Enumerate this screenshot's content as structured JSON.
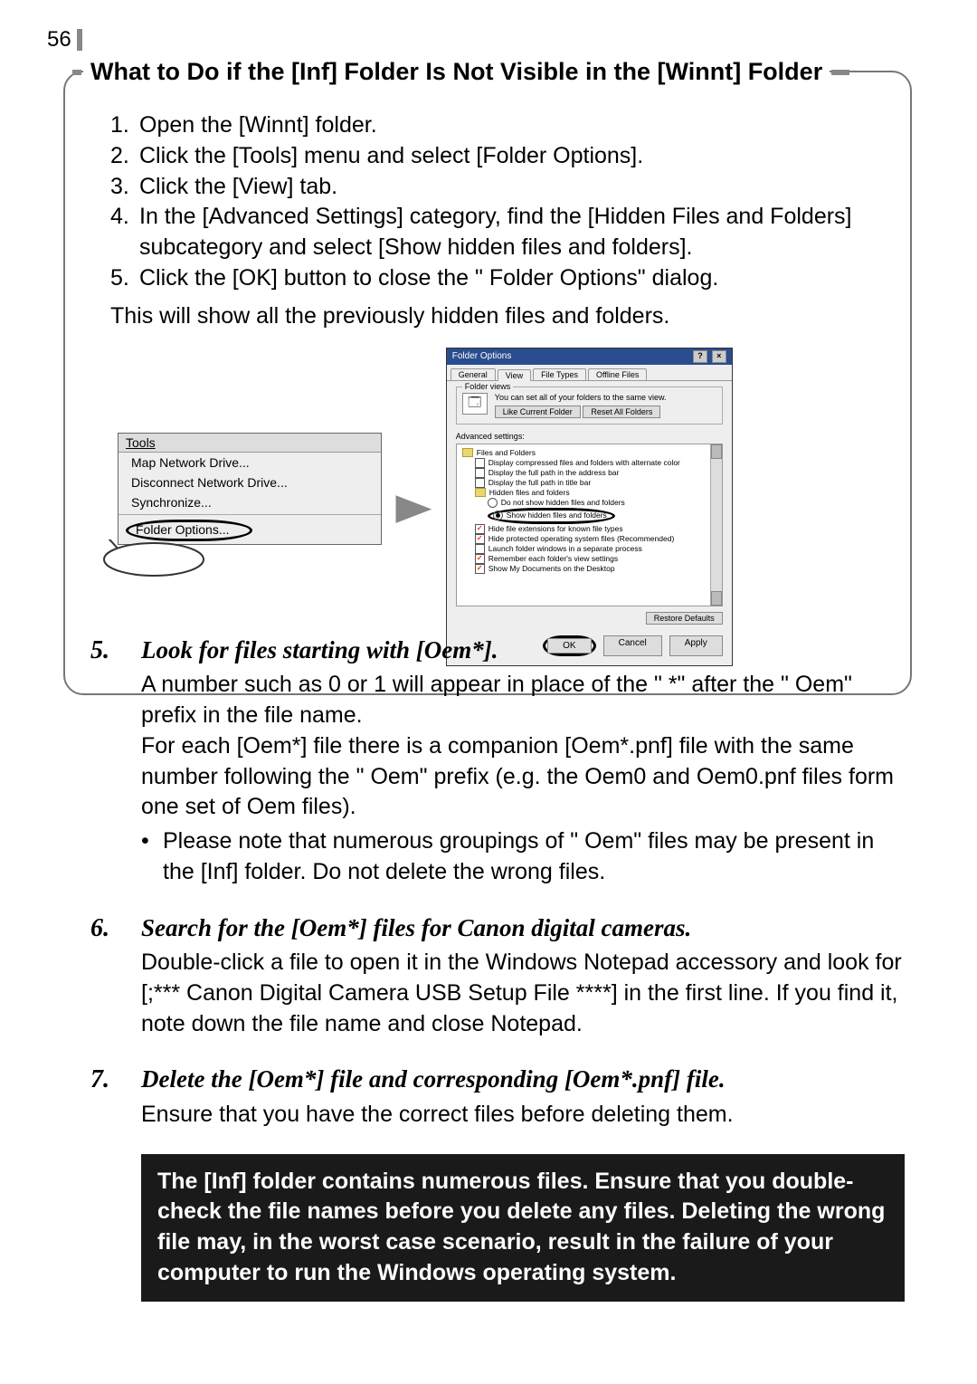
{
  "page_number": "56",
  "frame": {
    "title": "What to Do if the [Inf] Folder Is Not Visible in the [Winnt] Folder",
    "steps": [
      "Open the [Winnt] folder.",
      "Click the [Tools] menu and select [Folder Options].",
      "Click the [View] tab.",
      "In the [Advanced Settings] category, find the [Hidden Files and Folders] subcategory and select [Show hidden files and folders].",
      "Click the [OK] button to close the \" Folder Options\"  dialog."
    ],
    "closing": "This will show all the previously hidden files and folders."
  },
  "tools_menu": {
    "title": "Tools",
    "items": [
      "Map Network Drive...",
      "Disconnect Network Drive...",
      "Synchronize..."
    ],
    "highlighted": "Folder Options..."
  },
  "dialog": {
    "title": "Folder Options",
    "help_btn": "?",
    "close_btn": "×",
    "tabs": [
      "General",
      "View",
      "File Types",
      "Offline Files"
    ],
    "active_tab": "View",
    "folder_views": {
      "label": "Folder views",
      "text": "You can set all of your folders to the same view.",
      "btn1": "Like Current Folder",
      "btn2": "Reset All Folders"
    },
    "adv_label": "Advanced settings:",
    "tree": {
      "root": "Files and Folders",
      "c1": "Display compressed files and folders with alternate color",
      "c2": "Display the full path in the address bar",
      "c3": "Display the full path in title bar",
      "hf": "Hidden files and folders",
      "r1": "Do not show hidden files and folders",
      "r2": "Show hidden files and folders",
      "c4": "Hide file extensions for known file types",
      "c5": "Hide protected operating system files (Recommended)",
      "c6": "Launch folder windows in a separate process",
      "c7": "Remember each folder's view settings",
      "c8": "Show My Documents on the Desktop"
    },
    "restore": "Restore Defaults",
    "ok": "OK",
    "cancel": "Cancel",
    "apply": "Apply"
  },
  "body_steps": [
    {
      "num": "5.",
      "heading": "Look for files starting with [Oem*].",
      "paras": [
        "A number such as 0 or 1 will appear in place of the \" *\"  after the \" Oem\"  prefix in the file name.",
        "For each [Oem*] file there is a companion [Oem*.pnf] file with the same number following the \" Oem\"  prefix (e.g. the Oem0 and Oem0.pnf files form one set of Oem files)."
      ],
      "bullets": [
        "Please note that numerous groupings of \" Oem\"  files may be present in the [Inf] folder. Do not delete the wrong files."
      ]
    },
    {
      "num": "6.",
      "heading": "Search for the [Oem*] files for Canon digital cameras.",
      "paras": [
        "Double-click a file to open it in the Windows Notepad accessory and look for [;*** Canon Digital Camera USB Setup File ****] in the first line. If you find it, note down the file name and close Notepad."
      ],
      "bullets": []
    },
    {
      "num": "7.",
      "heading": "Delete the [Oem*] file and corresponding [Oem*.pnf] file.",
      "paras": [
        "Ensure that you have the correct files before deleting them."
      ],
      "bullets": []
    }
  ],
  "warning": "The [Inf] folder contains numerous files. Ensure that you double-check the file names before you delete any files. Deleting the wrong file may, in the worst case scenario, result in the failure of your computer to run the Windows operating system."
}
